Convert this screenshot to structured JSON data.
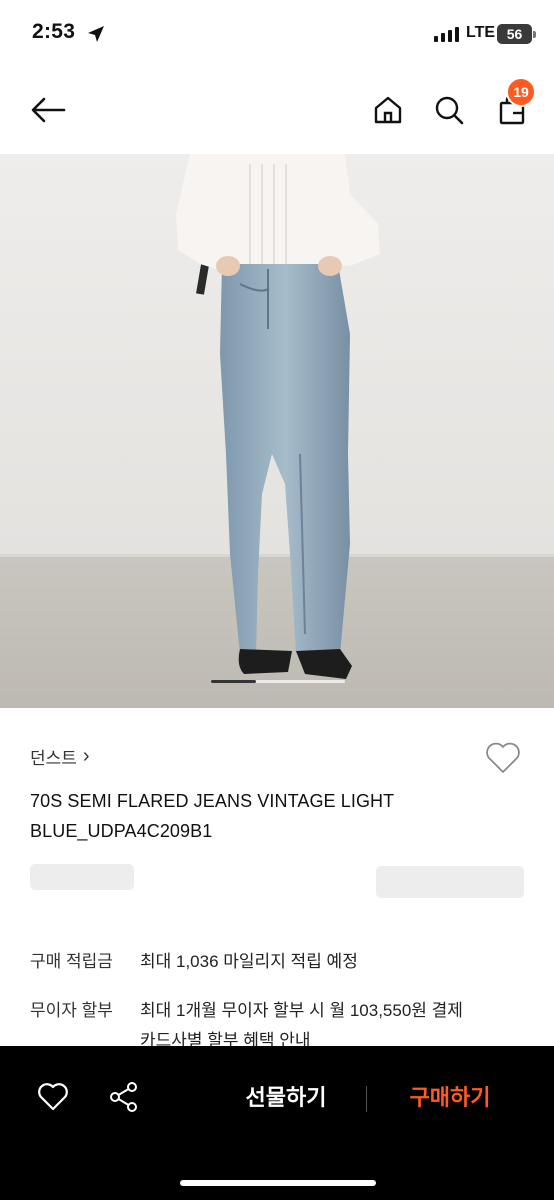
{
  "status_bar": {
    "time": "2:53",
    "network": "LTE",
    "battery": "56"
  },
  "nav": {
    "cart_count": "19"
  },
  "product": {
    "brand": "던스트",
    "brand_chevron": "›",
    "title": "70S SEMI FLARED JEANS VINTAGE LIGHT BLUE_UDPA4C209B1"
  },
  "info_rows": [
    {
      "label": "구매 적립금",
      "value": "최대 1,036 마일리지 적립 예정"
    },
    {
      "label": "무이자 할부",
      "value": "최대 1개월 무이자 할부 시 월 103,550원 결제",
      "sub": "카드사별 할부 혜택 안내"
    }
  ],
  "bottom_bar": {
    "gift_label": "선물하기",
    "buy_label": "구매하기"
  },
  "colors": {
    "accent": "#ff5a1f",
    "bottom_bar_bg": "#000000",
    "skeleton": "#ededed"
  },
  "icons": {
    "back": "back-arrow-icon",
    "home": "home-icon",
    "search": "search-icon",
    "cart": "shopping-bag-icon",
    "like": "heart-icon",
    "share": "share-icon"
  }
}
